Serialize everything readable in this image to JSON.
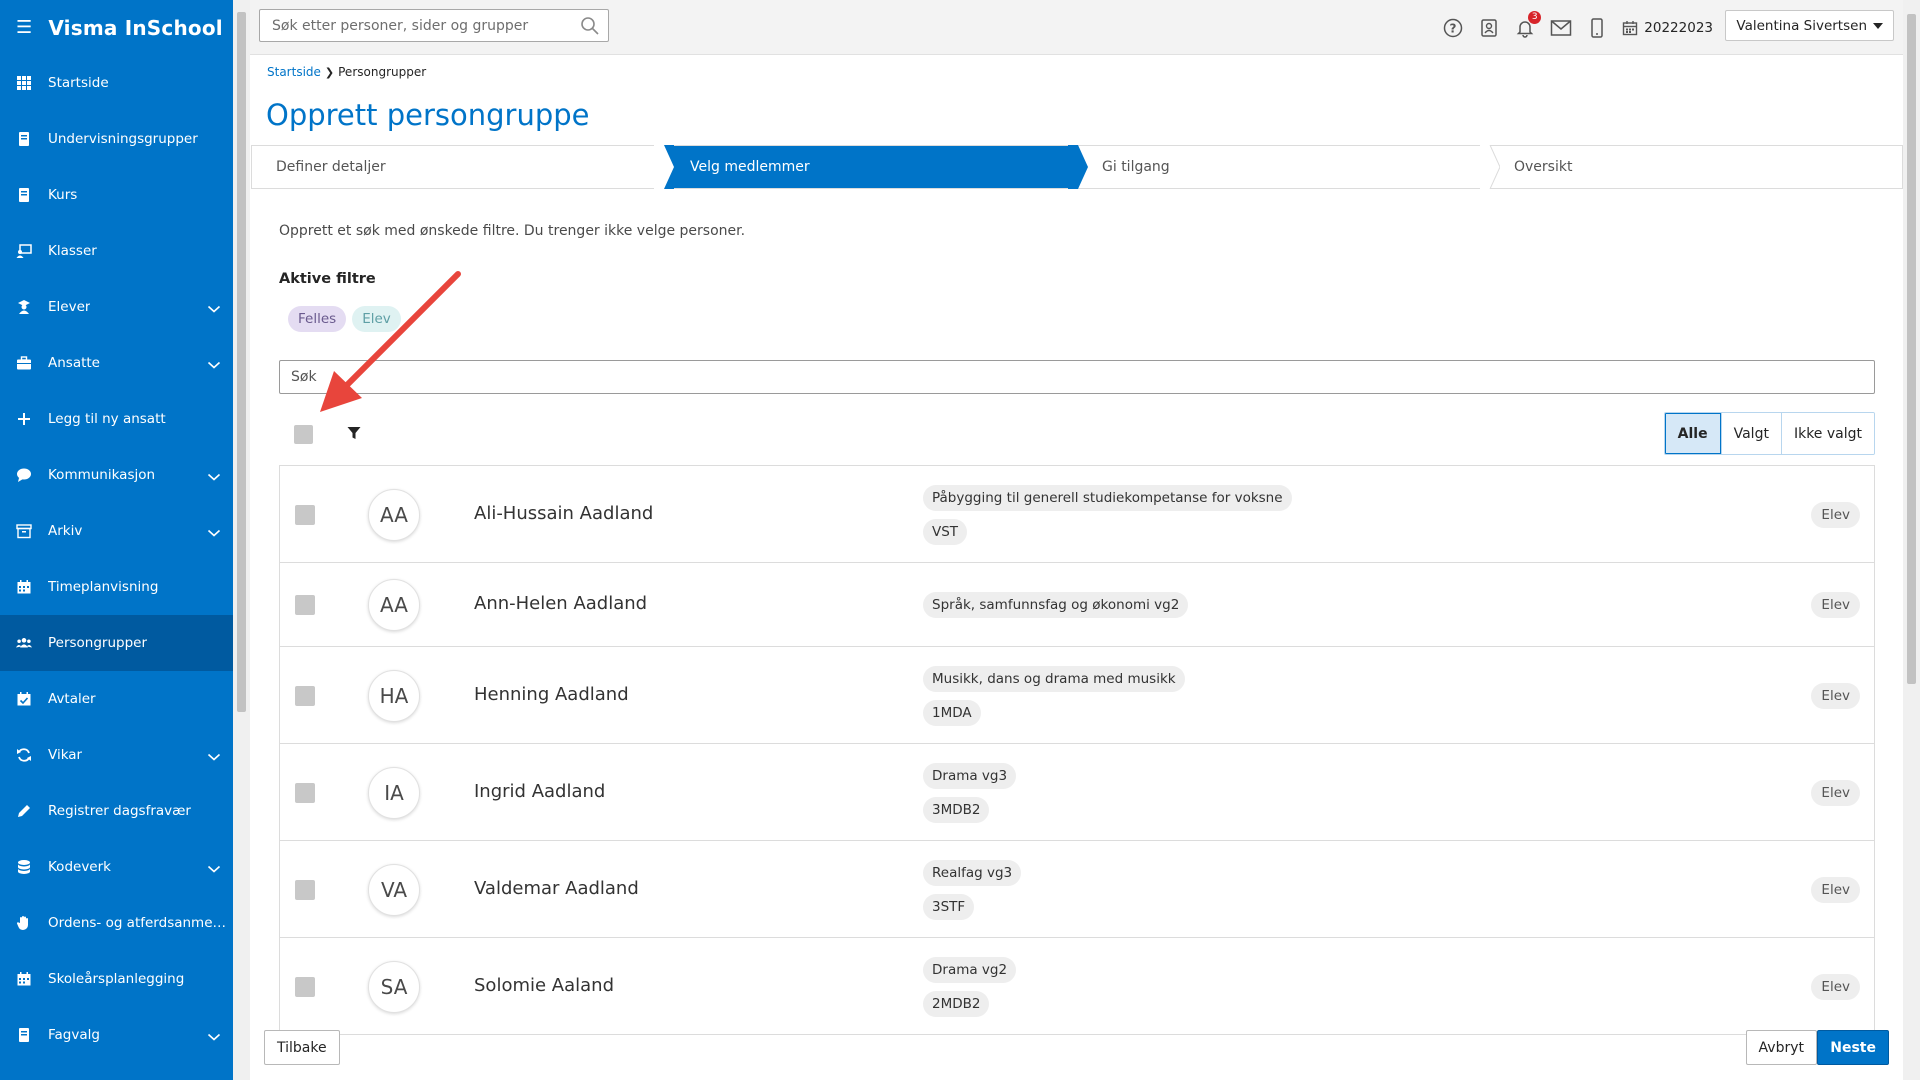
{
  "app": {
    "brand": "Visma InSchool"
  },
  "sidebar": {
    "items": [
      {
        "label": "Startside",
        "icon": "grid-icon",
        "expandable": false
      },
      {
        "label": "Undervisningsgrupper",
        "icon": "book-icon",
        "expandable": false
      },
      {
        "label": "Kurs",
        "icon": "book-icon",
        "expandable": false
      },
      {
        "label": "Klasser",
        "icon": "teacher-icon",
        "expandable": false
      },
      {
        "label": "Elever",
        "icon": "student-icon",
        "expandable": true
      },
      {
        "label": "Ansatte",
        "icon": "briefcase-icon",
        "expandable": true
      },
      {
        "label": "Legg til ny ansatt",
        "icon": "plus-icon",
        "expandable": false
      },
      {
        "label": "Kommunikasjon",
        "icon": "chat-icon",
        "expandable": true
      },
      {
        "label": "Arkiv",
        "icon": "archive-icon",
        "expandable": true
      },
      {
        "label": "Timeplanvisning",
        "icon": "calendar-icon",
        "expandable": false
      },
      {
        "label": "Persongrupper",
        "icon": "people-icon",
        "expandable": false,
        "active": true
      },
      {
        "label": "Avtaler",
        "icon": "calendar-check-icon",
        "expandable": false
      },
      {
        "label": "Vikar",
        "icon": "refresh-icon",
        "expandable": true
      },
      {
        "label": "Registrer dagsfravær",
        "icon": "pencil-icon",
        "expandable": false
      },
      {
        "label": "Kodeverk",
        "icon": "database-icon",
        "expandable": true
      },
      {
        "label": "Ordens- og atferdsanmerk...",
        "icon": "hand-icon",
        "expandable": false
      },
      {
        "label": "Skoleårsplanlegging",
        "icon": "calendar-icon",
        "expandable": false
      },
      {
        "label": "Fagvalg",
        "icon": "book-icon",
        "expandable": true
      }
    ]
  },
  "topbar": {
    "search_placeholder": "Søk etter personer, sider og grupper",
    "notification_count": "3",
    "school_year": "20222023",
    "user_name": "Valentina Sivertsen"
  },
  "breadcrumb": {
    "home": "Startside",
    "current": "Persongrupper"
  },
  "page": {
    "title": "Opprett persongruppe"
  },
  "stepper": {
    "steps": [
      {
        "label": "Definer detaljer",
        "active": false
      },
      {
        "label": "Velg medlemmer",
        "active": true
      },
      {
        "label": "Gi tilgang",
        "active": false
      },
      {
        "label": "Oversikt",
        "active": false
      }
    ]
  },
  "main": {
    "intro": "Opprett et søk med ønskede filtre. Du trenger ikke velge personer.",
    "active_filters_title": "Aktive filtre",
    "filters": [
      "Felles",
      "Elev"
    ],
    "search_placeholder": "Søk",
    "segments": [
      "Alle",
      "Valgt",
      "Ikke valgt"
    ],
    "active_segment": "Alle"
  },
  "people": [
    {
      "initials": "AA",
      "name": "Ali-Hussain Aadland",
      "tags": [
        "Påbygging til generell studiekompetanse for voksne",
        "VST"
      ],
      "role": "Elev"
    },
    {
      "initials": "AA",
      "name": "Ann-Helen Aadland",
      "tags": [
        "Språk, samfunnsfag og økonomi vg2"
      ],
      "role": "Elev"
    },
    {
      "initials": "HA",
      "name": "Henning Aadland",
      "tags": [
        "Musikk, dans og drama med musikk",
        "1MDA"
      ],
      "role": "Elev"
    },
    {
      "initials": "IA",
      "name": "Ingrid Aadland",
      "tags": [
        "Drama vg3",
        "3MDB2"
      ],
      "role": "Elev"
    },
    {
      "initials": "VA",
      "name": "Valdemar Aadland",
      "tags": [
        "Realfag vg3",
        "3STF"
      ],
      "role": "Elev"
    },
    {
      "initials": "SA",
      "name": "Solomie Aaland",
      "tags": [
        "Drama vg2",
        "2MDB2"
      ],
      "role": "Elev"
    }
  ],
  "footer": {
    "back": "Tilbake",
    "cancel": "Avbryt",
    "next": "Neste"
  },
  "colors": {
    "brand": "#0074c8",
    "sidebar_active": "#005aa0",
    "annotation": "#e8453c"
  }
}
